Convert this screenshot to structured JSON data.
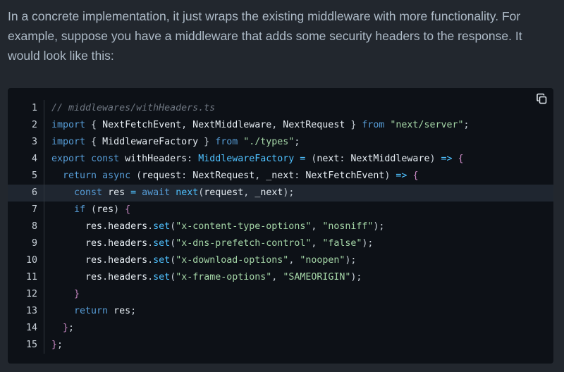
{
  "prose": {
    "paragraph": "In a concrete implementation, it just wraps the existing middleware with more functionality. For example, suppose you have a middleware that adds some security headers to the response. It would look like this:"
  },
  "code_block": {
    "copy_icon": "copy-icon",
    "active_line": 6,
    "lines": [
      {
        "num": "1",
        "tokens": [
          [
            "comment",
            "// middlewares/withHeaders.ts"
          ]
        ]
      },
      {
        "num": "2",
        "tokens": [
          [
            "kw",
            "import"
          ],
          [
            "punc",
            " { "
          ],
          [
            "ident",
            "NextFetchEvent"
          ],
          [
            "punc",
            ", "
          ],
          [
            "ident",
            "NextMiddleware"
          ],
          [
            "punc",
            ", "
          ],
          [
            "ident",
            "NextRequest"
          ],
          [
            "punc",
            " } "
          ],
          [
            "kw",
            "from"
          ],
          [
            "punc",
            " "
          ],
          [
            "str",
            "\"next/server\""
          ],
          [
            "punc",
            ";"
          ]
        ]
      },
      {
        "num": "3",
        "tokens": [
          [
            "kw",
            "import"
          ],
          [
            "punc",
            " { "
          ],
          [
            "ident",
            "MiddlewareFactory"
          ],
          [
            "punc",
            " } "
          ],
          [
            "kw",
            "from"
          ],
          [
            "punc",
            " "
          ],
          [
            "str",
            "\"./types\""
          ],
          [
            "punc",
            ";"
          ]
        ]
      },
      {
        "num": "4",
        "tokens": [
          [
            "kw",
            "export"
          ],
          [
            "punc",
            " "
          ],
          [
            "kw",
            "const"
          ],
          [
            "punc",
            " "
          ],
          [
            "ident",
            "withHeaders"
          ],
          [
            "punc",
            ": "
          ],
          [
            "type",
            "MiddlewareFactory"
          ],
          [
            "punc",
            " "
          ],
          [
            "op",
            "="
          ],
          [
            "punc",
            " ("
          ],
          [
            "ident",
            "next"
          ],
          [
            "punc",
            ": "
          ],
          [
            "ident",
            "NextMiddleware"
          ],
          [
            "punc",
            ") "
          ],
          [
            "op",
            "=>"
          ],
          [
            "punc",
            " "
          ],
          [
            "brace",
            "{"
          ]
        ]
      },
      {
        "num": "5",
        "tokens": [
          [
            "punc",
            "  "
          ],
          [
            "kw",
            "return"
          ],
          [
            "punc",
            " "
          ],
          [
            "kw",
            "async"
          ],
          [
            "punc",
            " ("
          ],
          [
            "ident",
            "request"
          ],
          [
            "punc",
            ": "
          ],
          [
            "ident",
            "NextRequest"
          ],
          [
            "punc",
            ", "
          ],
          [
            "ident",
            "_next"
          ],
          [
            "punc",
            ": "
          ],
          [
            "ident",
            "NextFetchEvent"
          ],
          [
            "punc",
            ") "
          ],
          [
            "op",
            "=>"
          ],
          [
            "punc",
            " "
          ],
          [
            "brace",
            "{"
          ]
        ]
      },
      {
        "num": "6",
        "tokens": [
          [
            "punc",
            "    "
          ],
          [
            "kw",
            "const"
          ],
          [
            "punc",
            " "
          ],
          [
            "ident",
            "res"
          ],
          [
            "punc",
            " "
          ],
          [
            "op",
            "="
          ],
          [
            "punc",
            " "
          ],
          [
            "kw",
            "await"
          ],
          [
            "punc",
            " "
          ],
          [
            "fn",
            "next"
          ],
          [
            "punc",
            "("
          ],
          [
            "ident",
            "request"
          ],
          [
            "punc",
            ", "
          ],
          [
            "ident",
            "_next"
          ],
          [
            "punc",
            ");"
          ]
        ]
      },
      {
        "num": "7",
        "tokens": [
          [
            "punc",
            "    "
          ],
          [
            "kw",
            "if"
          ],
          [
            "punc",
            " ("
          ],
          [
            "ident",
            "res"
          ],
          [
            "punc",
            ") "
          ],
          [
            "brace",
            "{"
          ]
        ]
      },
      {
        "num": "8",
        "tokens": [
          [
            "punc",
            "      "
          ],
          [
            "ident",
            "res"
          ],
          [
            "punc",
            "."
          ],
          [
            "ident",
            "headers"
          ],
          [
            "punc",
            "."
          ],
          [
            "fn",
            "set"
          ],
          [
            "punc",
            "("
          ],
          [
            "str",
            "\"x-content-type-options\""
          ],
          [
            "punc",
            ", "
          ],
          [
            "str",
            "\"nosniff\""
          ],
          [
            "punc",
            ");"
          ]
        ]
      },
      {
        "num": "9",
        "tokens": [
          [
            "punc",
            "      "
          ],
          [
            "ident",
            "res"
          ],
          [
            "punc",
            "."
          ],
          [
            "ident",
            "headers"
          ],
          [
            "punc",
            "."
          ],
          [
            "fn",
            "set"
          ],
          [
            "punc",
            "("
          ],
          [
            "str",
            "\"x-dns-prefetch-control\""
          ],
          [
            "punc",
            ", "
          ],
          [
            "str",
            "\"false\""
          ],
          [
            "punc",
            ");"
          ]
        ]
      },
      {
        "num": "10",
        "tokens": [
          [
            "punc",
            "      "
          ],
          [
            "ident",
            "res"
          ],
          [
            "punc",
            "."
          ],
          [
            "ident",
            "headers"
          ],
          [
            "punc",
            "."
          ],
          [
            "fn",
            "set"
          ],
          [
            "punc",
            "("
          ],
          [
            "str",
            "\"x-download-options\""
          ],
          [
            "punc",
            ", "
          ],
          [
            "str",
            "\"noopen\""
          ],
          [
            "punc",
            ");"
          ]
        ]
      },
      {
        "num": "11",
        "tokens": [
          [
            "punc",
            "      "
          ],
          [
            "ident",
            "res"
          ],
          [
            "punc",
            "."
          ],
          [
            "ident",
            "headers"
          ],
          [
            "punc",
            "."
          ],
          [
            "fn",
            "set"
          ],
          [
            "punc",
            "("
          ],
          [
            "str",
            "\"x-frame-options\""
          ],
          [
            "punc",
            ", "
          ],
          [
            "str",
            "\"SAMEORIGIN\""
          ],
          [
            "punc",
            ");"
          ]
        ]
      },
      {
        "num": "12",
        "tokens": [
          [
            "punc",
            "    "
          ],
          [
            "brace",
            "}"
          ]
        ]
      },
      {
        "num": "13",
        "tokens": [
          [
            "punc",
            "    "
          ],
          [
            "kw",
            "return"
          ],
          [
            "punc",
            " "
          ],
          [
            "ident",
            "res"
          ],
          [
            "punc",
            ";"
          ]
        ]
      },
      {
        "num": "14",
        "tokens": [
          [
            "punc",
            "  "
          ],
          [
            "brace",
            "}"
          ],
          [
            "punc",
            ";"
          ]
        ]
      },
      {
        "num": "15",
        "tokens": [
          [
            "brace",
            "}"
          ],
          [
            "punc",
            ";"
          ]
        ]
      }
    ]
  }
}
